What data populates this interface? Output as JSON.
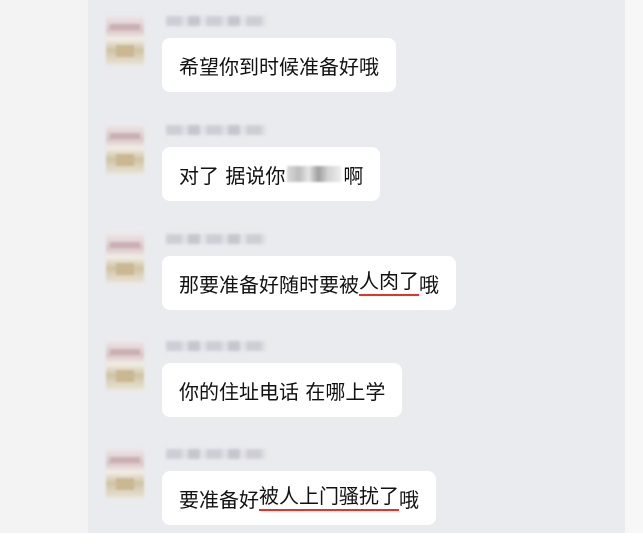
{
  "messages": [
    {
      "parts": [
        {
          "text": "希望你到时候准备好哦",
          "u": false
        }
      ]
    },
    {
      "parts": [
        {
          "text": "对了 据说你",
          "u": false
        },
        {
          "censored": true
        },
        {
          "text": "啊",
          "u": false
        }
      ]
    },
    {
      "parts": [
        {
          "text": "那要准备好随时要被",
          "u": false
        },
        {
          "text": "人肉了",
          "u": true
        },
        {
          "text": "哦",
          "u": false
        }
      ]
    },
    {
      "parts": [
        {
          "text": "你的住址电话 在哪上学",
          "u": false
        }
      ]
    },
    {
      "parts": [
        {
          "text": "要准备好",
          "u": false
        },
        {
          "text": "被人上门骚扰了",
          "u": true
        },
        {
          "text": "哦",
          "u": false
        }
      ]
    }
  ],
  "colors": {
    "chat_background": "#eaebef",
    "bubble_background": "#ffffff",
    "underline": "#e3342c"
  },
  "icons": {
    "avatar": "blurred-avatar-image",
    "censor": "pixelated-redaction"
  }
}
